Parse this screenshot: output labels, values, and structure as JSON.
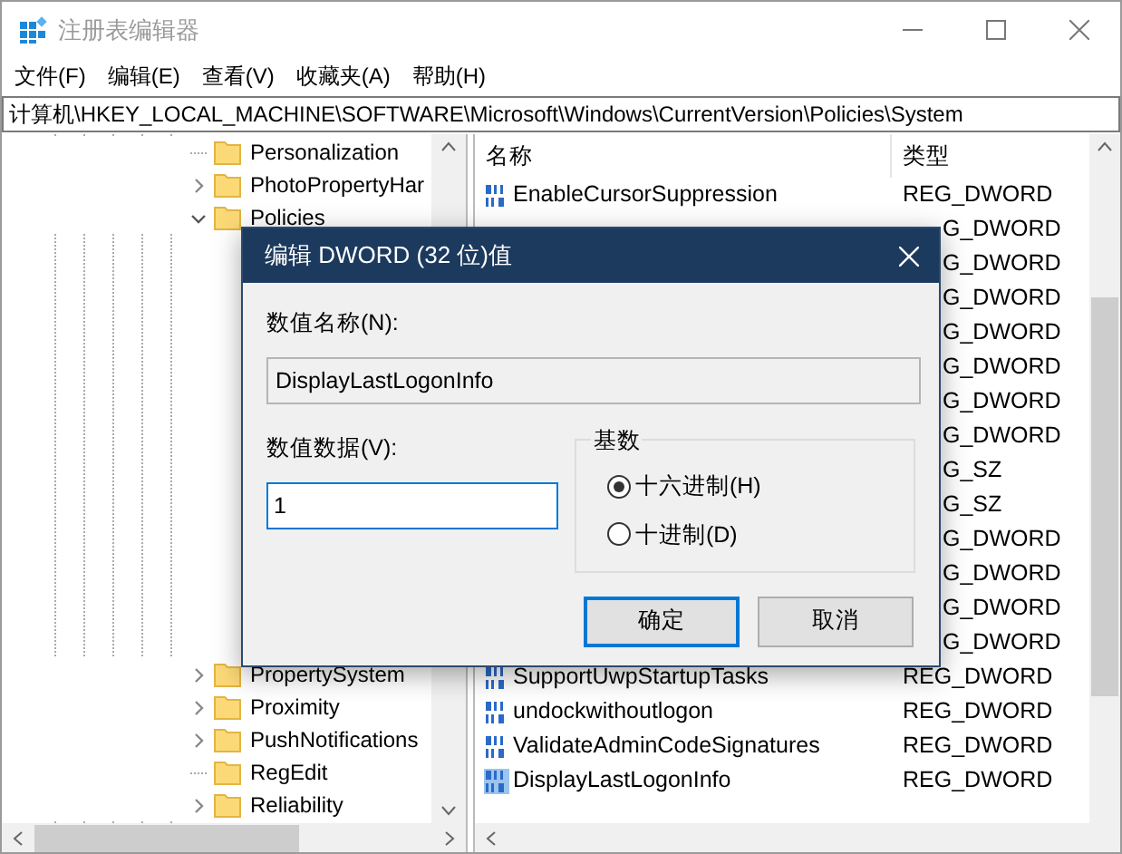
{
  "window": {
    "title": "注册表编辑器"
  },
  "menu": [
    "文件(F)",
    "编辑(E)",
    "查看(V)",
    "收藏夹(A)",
    "帮助(H)"
  ],
  "address": "计算机\\HKEY_LOCAL_MACHINE\\SOFTWARE\\Microsoft\\Windows\\CurrentVersion\\Policies\\System",
  "tree": [
    {
      "label": "Personalization",
      "kind": "leaf"
    },
    {
      "label": "PhotoPropertyHar",
      "kind": "collapsed"
    },
    {
      "label": "Policies",
      "kind": "expanded"
    },
    {
      "label": "PropertySystem",
      "kind": "collapsed"
    },
    {
      "label": "Proximity",
      "kind": "collapsed"
    },
    {
      "label": "PushNotifications",
      "kind": "collapsed"
    },
    {
      "label": "RegEdit",
      "kind": "leaf"
    },
    {
      "label": "Reliability",
      "kind": "collapsed"
    }
  ],
  "list": {
    "columns": [
      "名称",
      "类型"
    ],
    "rows": [
      {
        "name": "EnableCursorSuppression",
        "type": "REG_DWORD",
        "selected": false
      },
      {
        "type": "G_DWORD"
      },
      {
        "type": "G_DWORD"
      },
      {
        "type": "G_DWORD"
      },
      {
        "type": "G_DWORD"
      },
      {
        "type": "G_DWORD"
      },
      {
        "type": "G_DWORD"
      },
      {
        "type": "G_DWORD"
      },
      {
        "type": "G_SZ"
      },
      {
        "type": "G_SZ"
      },
      {
        "type": "G_DWORD"
      },
      {
        "type": "G_DWORD"
      },
      {
        "type": "G_DWORD"
      },
      {
        "type": "G_DWORD"
      },
      {
        "name": "SupportUwpStartupTasks",
        "type": "REG_DWORD",
        "selected": false
      },
      {
        "name": "undockwithoutlogon",
        "type": "REG_DWORD",
        "selected": false
      },
      {
        "name": "ValidateAdminCodeSignatures",
        "type": "REG_DWORD",
        "selected": false
      },
      {
        "name": "DisplayLastLogonInfo",
        "type": "REG_DWORD",
        "selected": true
      }
    ]
  },
  "dialog": {
    "title": "编辑 DWORD (32 位)值",
    "name_label": "数值名称(N):",
    "name_value": "DisplayLastLogonInfo",
    "data_label": "数值数据(V):",
    "data_value": "1",
    "base": {
      "title": "基数",
      "options": [
        {
          "label": "十六进制(H)",
          "selected": true
        },
        {
          "label": "十进制(D)",
          "selected": false
        }
      ]
    },
    "buttons": [
      {
        "label": "确定",
        "default": true
      },
      {
        "label": "取消",
        "default": false
      }
    ]
  }
}
